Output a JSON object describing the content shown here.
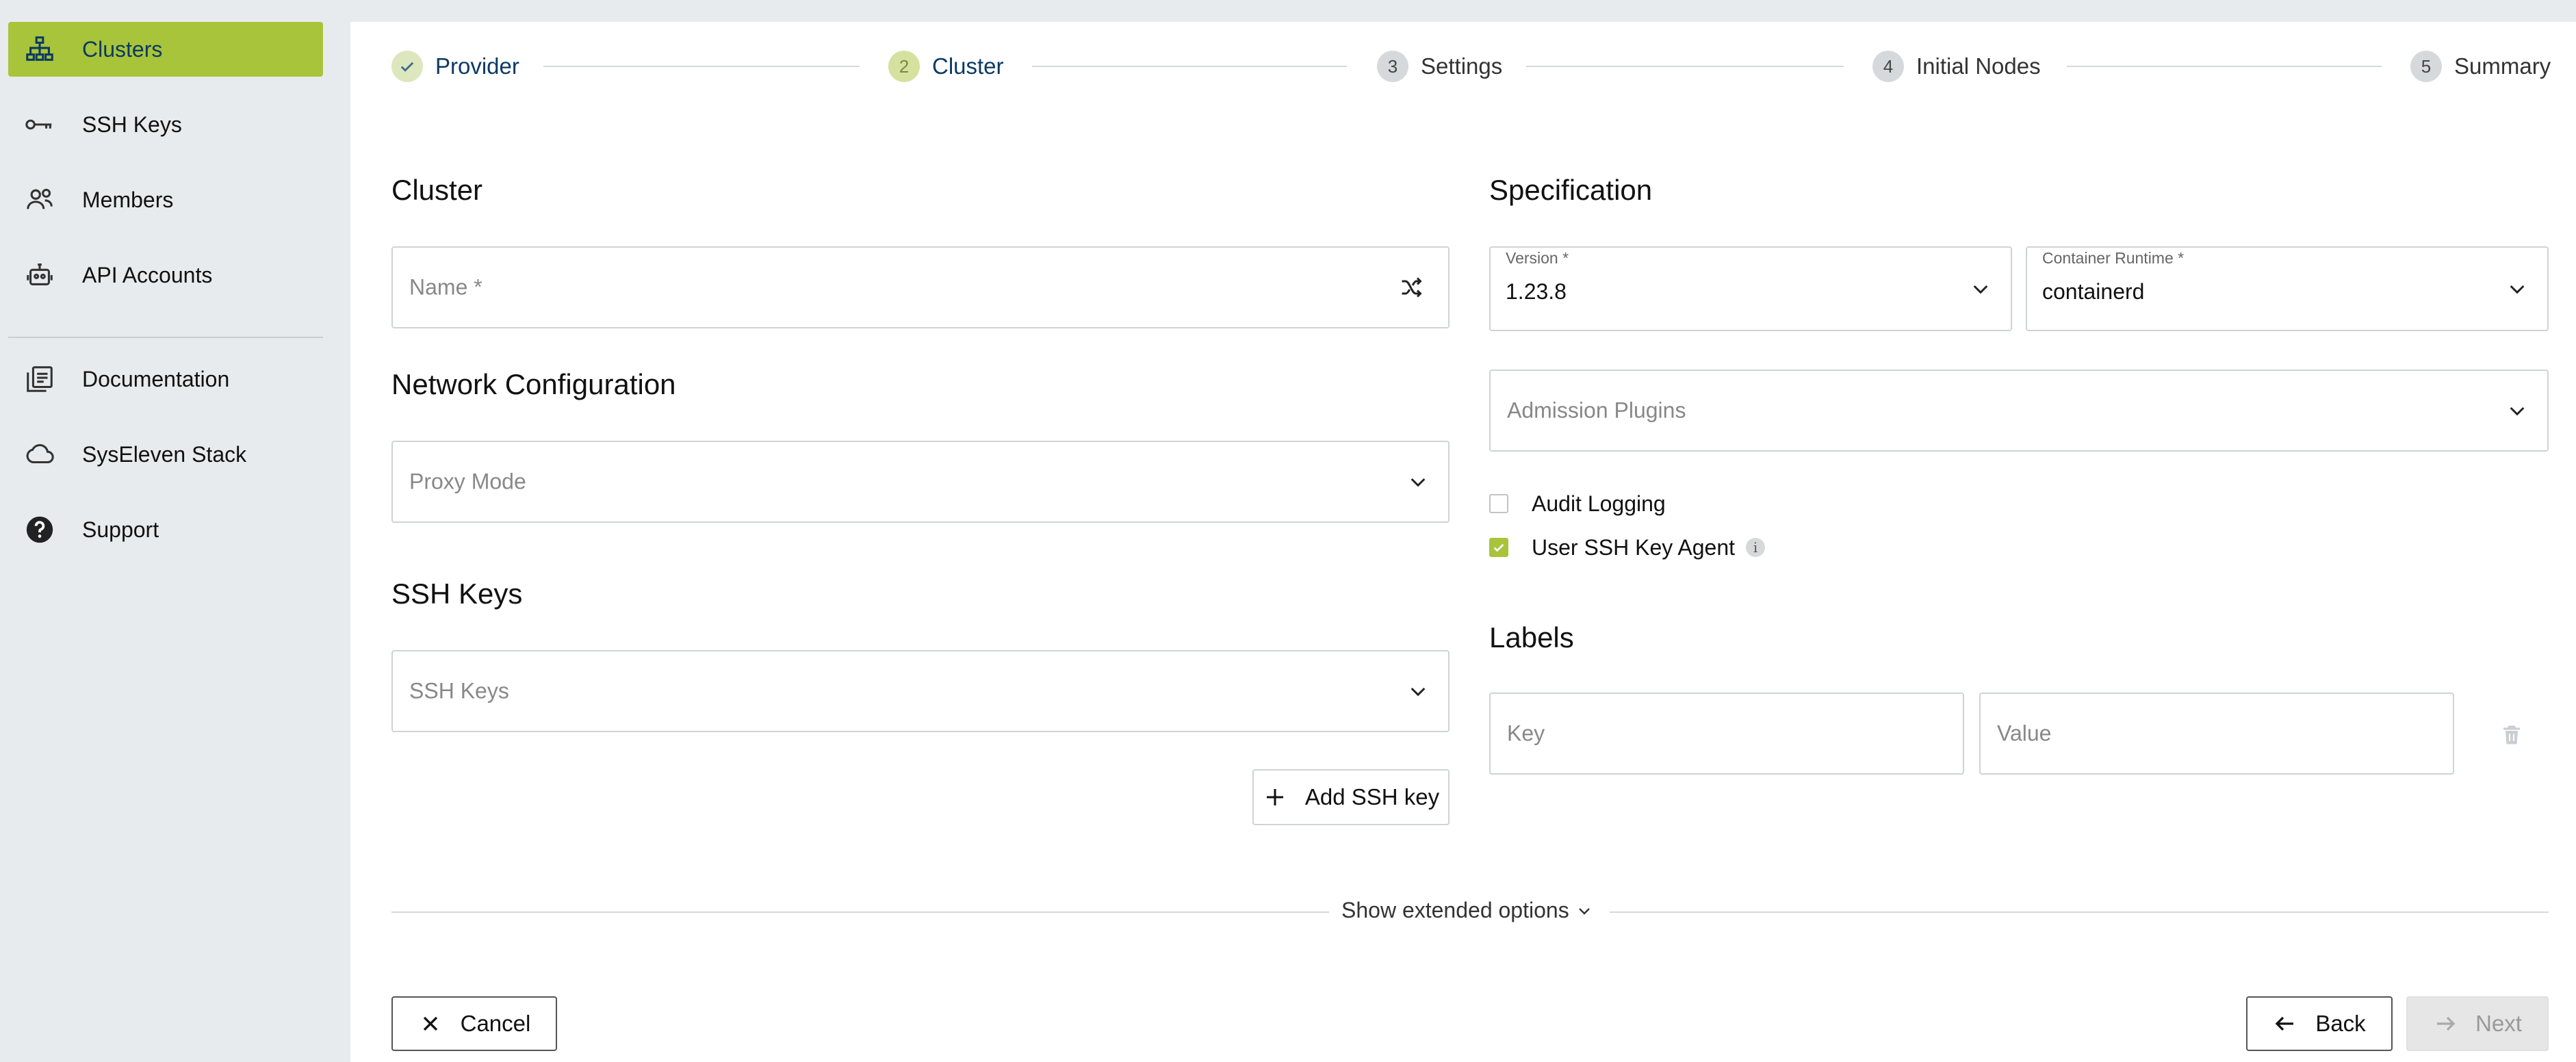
{
  "sidebar": {
    "items": [
      {
        "label": "Clusters",
        "icon": "clusters-icon",
        "active": true
      },
      {
        "label": "SSH Keys",
        "icon": "key-icon"
      },
      {
        "label": "Members",
        "icon": "members-icon"
      },
      {
        "label": "API Accounts",
        "icon": "robot-icon"
      },
      {
        "label": "Documentation",
        "icon": "documentation-icon"
      },
      {
        "label": "SysEleven Stack",
        "icon": "cloud-icon"
      },
      {
        "label": "Support",
        "icon": "help-icon"
      }
    ]
  },
  "stepper": {
    "steps": [
      {
        "number": "✓",
        "label": "Provider",
        "state": "done"
      },
      {
        "number": "2",
        "label": "Cluster",
        "state": "current"
      },
      {
        "number": "3",
        "label": "Settings",
        "state": "pending"
      },
      {
        "number": "4",
        "label": "Initial Nodes",
        "state": "pending"
      },
      {
        "number": "5",
        "label": "Summary",
        "state": "pending"
      }
    ]
  },
  "cluster": {
    "title": "Cluster",
    "name_placeholder": "Name *"
  },
  "network": {
    "title": "Network Configuration",
    "proxy_mode_placeholder": "Proxy Mode"
  },
  "ssh": {
    "title": "SSH Keys",
    "select_placeholder": "SSH Keys",
    "add_button": "Add SSH key"
  },
  "specification": {
    "title": "Specification",
    "version_label": "Version *",
    "version_value": "1.23.8",
    "runtime_label": "Container Runtime *",
    "runtime_value": "containerd",
    "admission_placeholder": "Admission Plugins",
    "audit_logging": {
      "label": "Audit Logging",
      "checked": false
    },
    "ssh_key_agent": {
      "label": "User SSH Key Agent",
      "checked": true,
      "info": "i"
    }
  },
  "labels": {
    "title": "Labels",
    "key_placeholder": "Key",
    "value_placeholder": "Value"
  },
  "extended": {
    "label": "Show extended options"
  },
  "footer": {
    "cancel": "Cancel",
    "back": "Back",
    "next": "Next"
  },
  "colors": {
    "accent": "#a8c43a",
    "nav_blue": "#0c3a63",
    "background": "#e8ebed"
  }
}
